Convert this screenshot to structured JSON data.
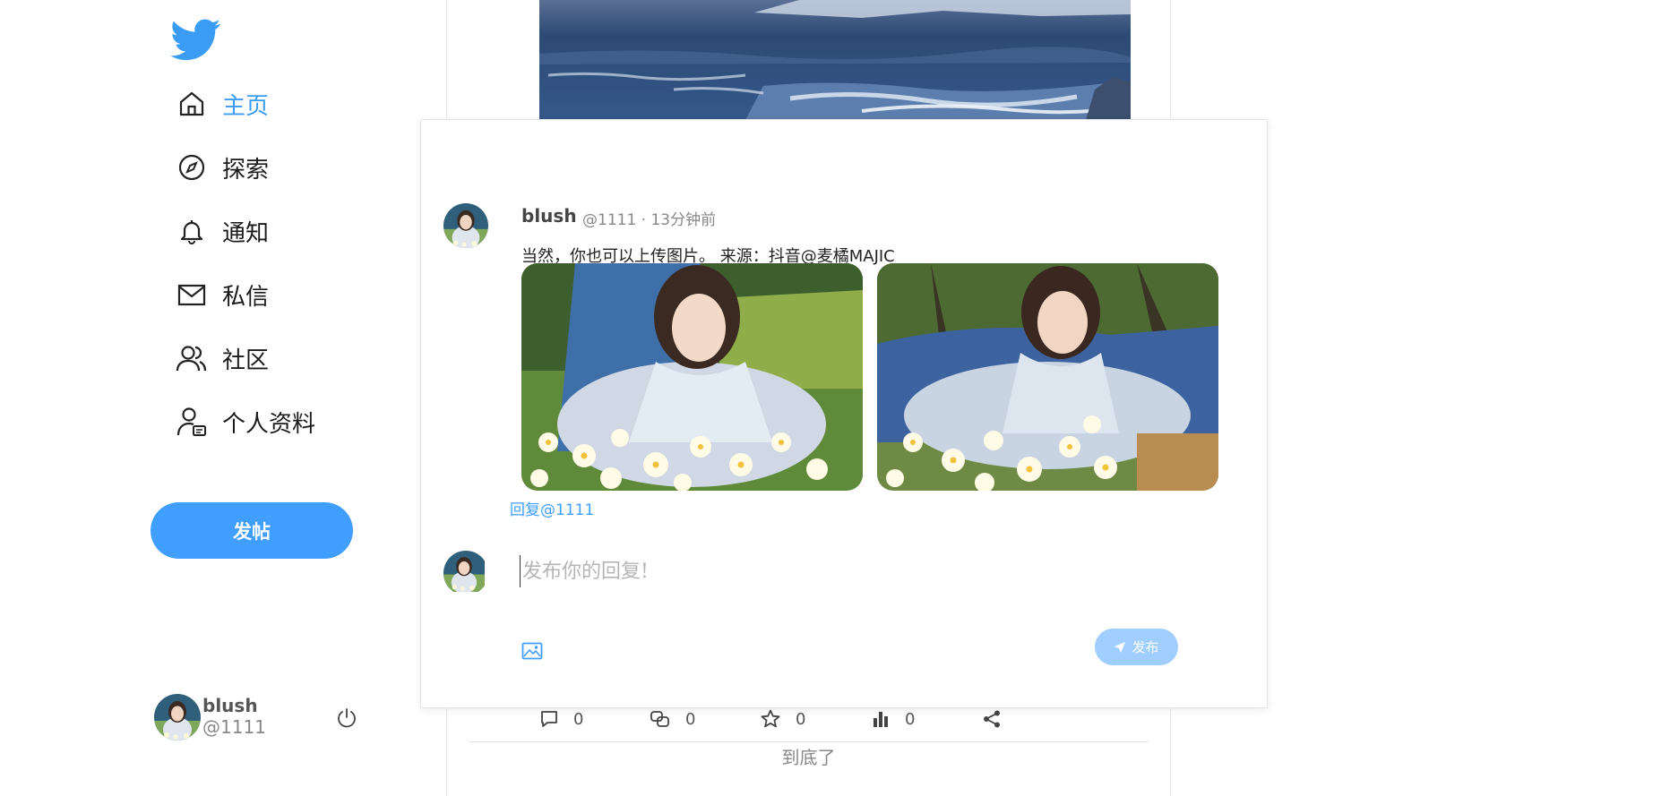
{
  "sidebar": {
    "logo": "twitter-bird-icon",
    "nav": [
      {
        "label": "主页",
        "icon": "home-icon",
        "active": true
      },
      {
        "label": "探索",
        "icon": "compass-icon",
        "active": false
      },
      {
        "label": "通知",
        "icon": "bell-icon",
        "active": false
      },
      {
        "label": "私信",
        "icon": "mail-icon",
        "active": false
      },
      {
        "label": "社区",
        "icon": "users-icon",
        "active": false
      },
      {
        "label": "个人资料",
        "icon": "profile-icon",
        "active": false
      }
    ],
    "post_button": "发帖",
    "user": {
      "name": "blush",
      "handle": "@1111"
    }
  },
  "feed": {
    "actions": [
      {
        "icon": "comment-icon",
        "count": "0"
      },
      {
        "icon": "repost-icon",
        "count": "0"
      },
      {
        "icon": "star-icon",
        "count": "0"
      },
      {
        "icon": "stats-icon",
        "count": "0"
      },
      {
        "icon": "share-icon",
        "count": ""
      }
    ],
    "end_text": "到底了"
  },
  "modal": {
    "post": {
      "author": "blush",
      "meta": "@1111 · 13分钟前",
      "text": "当然，你也可以上传图片。 来源：抖音@麦橘MAJIC"
    },
    "reply_to": "回复@1111",
    "reply_placeholder": "发布你的回复!",
    "send_label": "发布"
  },
  "colors": {
    "accent": "#409eff",
    "active_nav": "#3b9cf5",
    "send_disabled": "#a0cfff"
  }
}
